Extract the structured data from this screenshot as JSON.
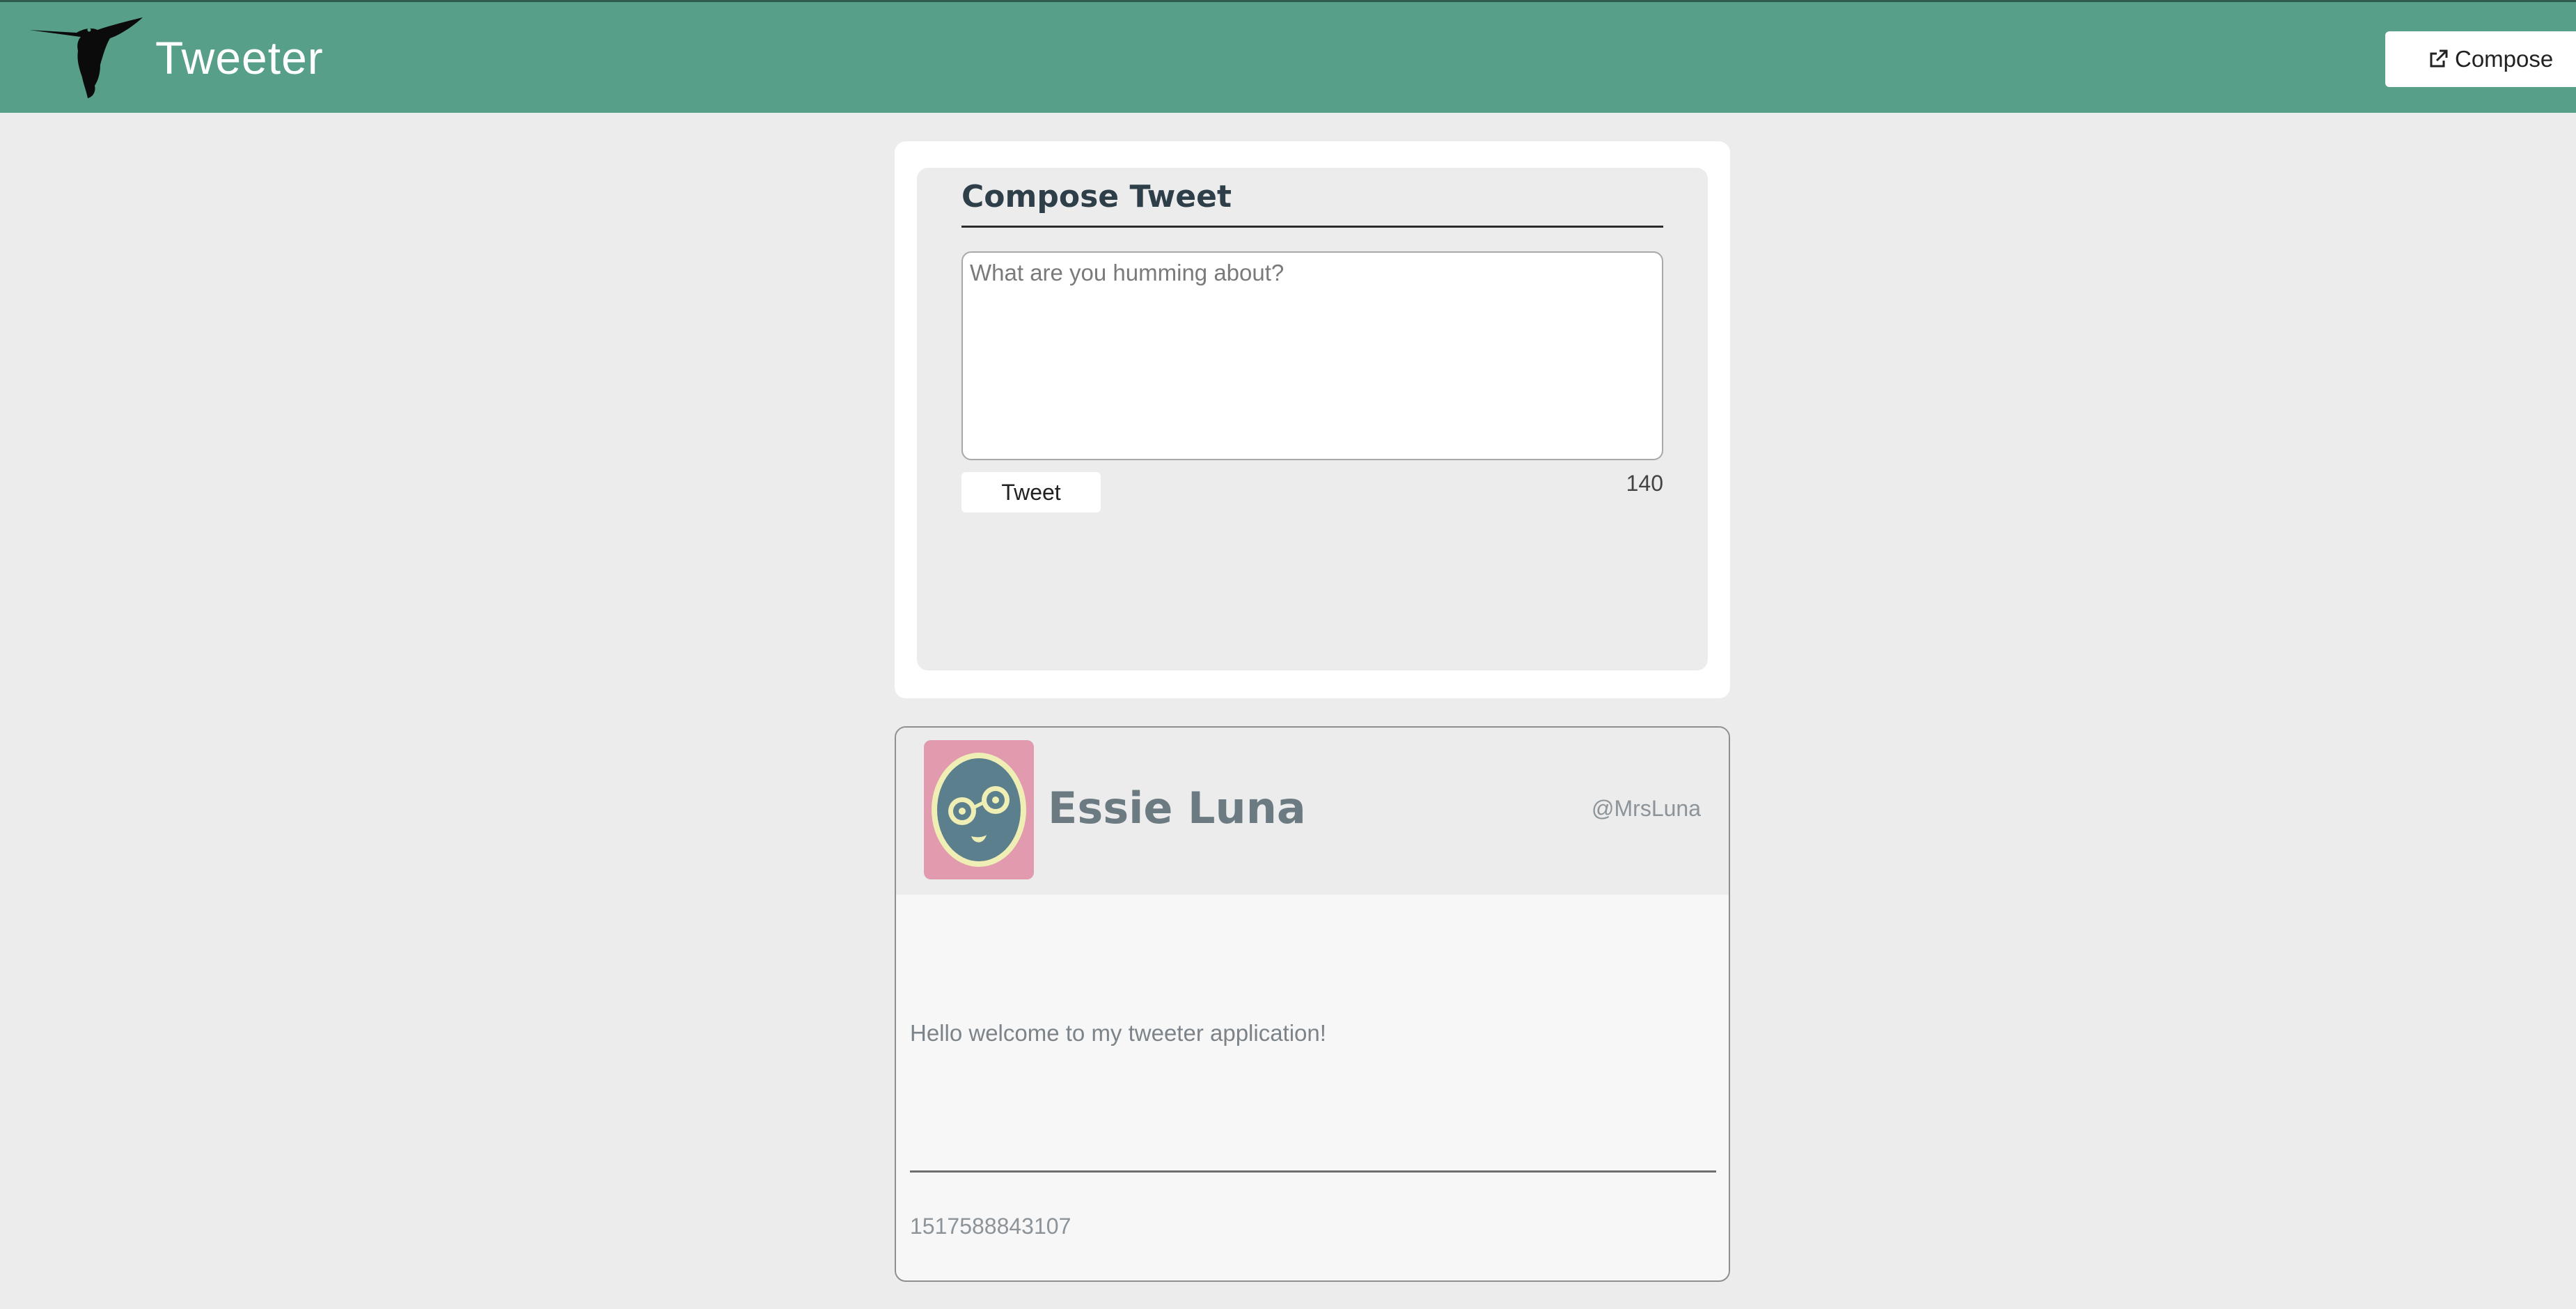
{
  "nav": {
    "brand": "Tweeter",
    "compose_label": "Compose"
  },
  "compose": {
    "title": "Compose Tweet",
    "placeholder": "What are you humming about?",
    "submit_label": "Tweet",
    "counter": "140"
  },
  "tweet": {
    "name": "Essie Luna",
    "handle": "@MrsLuna",
    "content": "Hello welcome to my tweeter application!",
    "timestamp": "1517588843107"
  },
  "colors": {
    "nav_bg": "#579f88",
    "page_bg": "#ececec",
    "avatar_bg": "#e19aae"
  },
  "icons": {
    "logo": "hummingbird-icon",
    "compose": "external-link-icon",
    "avatar": "face-with-glasses-icon"
  }
}
